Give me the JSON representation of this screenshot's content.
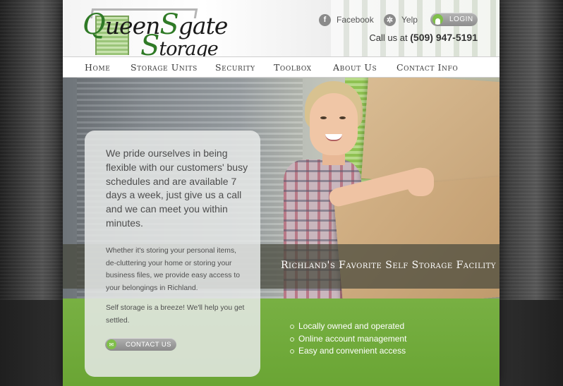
{
  "brand": {
    "logo_line1": "QueenSgate",
    "logo_line2": "Storage",
    "accent": "#78b043"
  },
  "header": {
    "facebook_label": "Facebook",
    "yelp_label": "Yelp",
    "login_label": "LOGIN",
    "phone_prefix": "Call us at",
    "phone_number": "(509) 947-5191"
  },
  "nav": {
    "items": [
      {
        "label": "Home"
      },
      {
        "label": "Storage Units"
      },
      {
        "label": "Security"
      },
      {
        "label": "Toolbox"
      },
      {
        "label": "About Us"
      },
      {
        "label": "Contact Info"
      }
    ]
  },
  "hero": {
    "tagline": "Richland's Favorite Self Storage Facility"
  },
  "panel": {
    "lead": "We pride ourselves in being flexible with our customers' busy schedules and are available 7 days a week, just give us a call and we can meet you within minutes.",
    "body1": "Whether it's storing your personal items, de-cluttering your home or storing your business files, we provide easy access to your belongings in Richland.",
    "body2": "Self storage is a breeze! We'll help you get settled.",
    "contact_button": "CONTACT US"
  },
  "features": [
    "Locally owned and operated",
    "Online account management",
    "Easy and convenient access"
  ],
  "icons": {
    "facebook": "facebook-icon",
    "yelp": "yelp-icon",
    "login": "user-icon",
    "contact": "mail-icon"
  }
}
